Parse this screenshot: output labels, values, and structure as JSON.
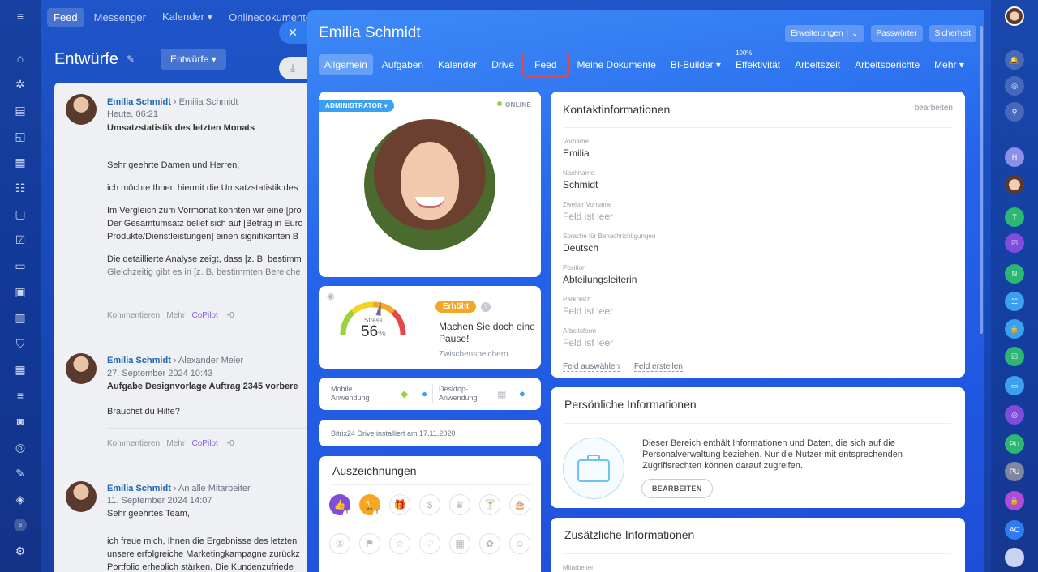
{
  "background": {
    "nav": [
      "Feed",
      "Messenger",
      "Kalender",
      "Onlinedokumente"
    ],
    "page_title": "Entwürfe",
    "drafts_button": "Entwürfe",
    "posts": [
      {
        "author": "Emilia Schmidt",
        "recipient": "Emilia Schmidt",
        "date": "Heute, 06:21",
        "title": "Umsatzstatistik des letzten Monats",
        "body": [
          "Sehr geehrte Damen und Herren,",
          "ich möchte Ihnen hiermit die Umsatzstatistik des",
          "Im Vergleich zum Vormonat konnten wir eine [pro",
          "Der Gesamtumsatz belief sich auf [Betrag in Euro",
          "Produkte/Dienstleistungen] einen signifikanten B",
          "Die detaillierte Analyse zeigt, dass [z. B. bestimm",
          "Gleichzeitig gibt es in [z. B. bestimmten Bereiche"
        ],
        "actions": [
          "Kommentieren",
          "Mehr",
          "CoPilot",
          "0"
        ]
      },
      {
        "author": "Emilia Schmidt",
        "recipient": "Alexander Meier",
        "date": "27. September 2024 10:43",
        "title": "Aufgabe Designvorlage Auftrag 2345 vorbere",
        "body": [
          "Brauchst du Hilfe?"
        ],
        "actions": [
          "Kommentieren",
          "Mehr",
          "CoPilot",
          "0"
        ]
      },
      {
        "author": "Emilia Schmidt",
        "recipient": "An alle Mitarbeiter",
        "date": "11. September 2024 14:07",
        "title": "Sehr geehrtes Team,",
        "body": [
          "ich freue mich, Ihnen die Ergebnisse des letzten",
          "unsere erfolgreiche Marketingkampagne zurückz",
          "Portfolio erheblich stärken. Die Kundenzufriede"
        ],
        "actions": []
      }
    ]
  },
  "profile": {
    "name": "Emilia Schmidt",
    "head_buttons": {
      "extensions": "Erweiterungen",
      "passwords": "Passwörter",
      "security": "Sicherheit"
    },
    "tabs": [
      "Allgemein",
      "Aufgaben",
      "Kalender",
      "Drive",
      "Feed",
      "Meine Dokumente",
      "BI-Builder",
      "Effektivität",
      "Arbeitszeit",
      "Arbeitsberichte",
      "Mehr"
    ],
    "efficiency_pct": "100%",
    "role_tag": "ADMINISTRATOR",
    "status": "ONLINE",
    "stress": {
      "label": "Stress",
      "value": "56",
      "unit": "%",
      "level": 0.56,
      "badge": "Erhöht",
      "message": "Machen Sie doch eine Pause!",
      "save": "Zwischenspeichern"
    },
    "apps": {
      "mobile": "Mobile Anwendung",
      "desktop": "Desktop-Anwendung"
    },
    "drive_note": "Bitrix24 Drive installiert am 17.11.2020",
    "awards": {
      "title": "Auszeichnungen",
      "like_count": "1",
      "cup_count": "1"
    },
    "contact": {
      "title": "Kontaktinformationen",
      "edit": "bearbeiten",
      "fields": [
        {
          "label": "Vorname",
          "value": "Emilia"
        },
        {
          "label": "Nachname",
          "value": "Schmidt"
        },
        {
          "label": "Zweiter Vorname",
          "value": "Feld ist leer"
        },
        {
          "label": "Sprache für Benachrichtigungen",
          "value": "Deutsch"
        },
        {
          "label": "Position",
          "value": "Abteilungsleiterin"
        },
        {
          "label": "Parkplatz",
          "value": "Feld ist leer"
        },
        {
          "label": "Arbeitsform",
          "value": "Feld ist leer"
        }
      ],
      "select_field": "Feld auswählen",
      "create_field": "Feld erstellen"
    },
    "personal": {
      "title": "Persönliche Informationen",
      "text": "Dieser Bereich enthält Informationen und Daten, die sich auf die Personalverwaltung beziehen. Nur die Nutzer mit entsprechenden Zugriffsrechten können darauf zugreifen.",
      "button": "BEARBEITEN"
    },
    "additional": {
      "title": "Zusätzliche Informationen",
      "first_label": "Mitarbeiter"
    }
  },
  "right_rail": [
    "H",
    "T",
    "N",
    "PU",
    "PU",
    "AC"
  ],
  "colors": {
    "accent": "#2f7bf0",
    "highlight": "#e34848",
    "badge": "#f5a623",
    "online": "#9bd13c"
  }
}
